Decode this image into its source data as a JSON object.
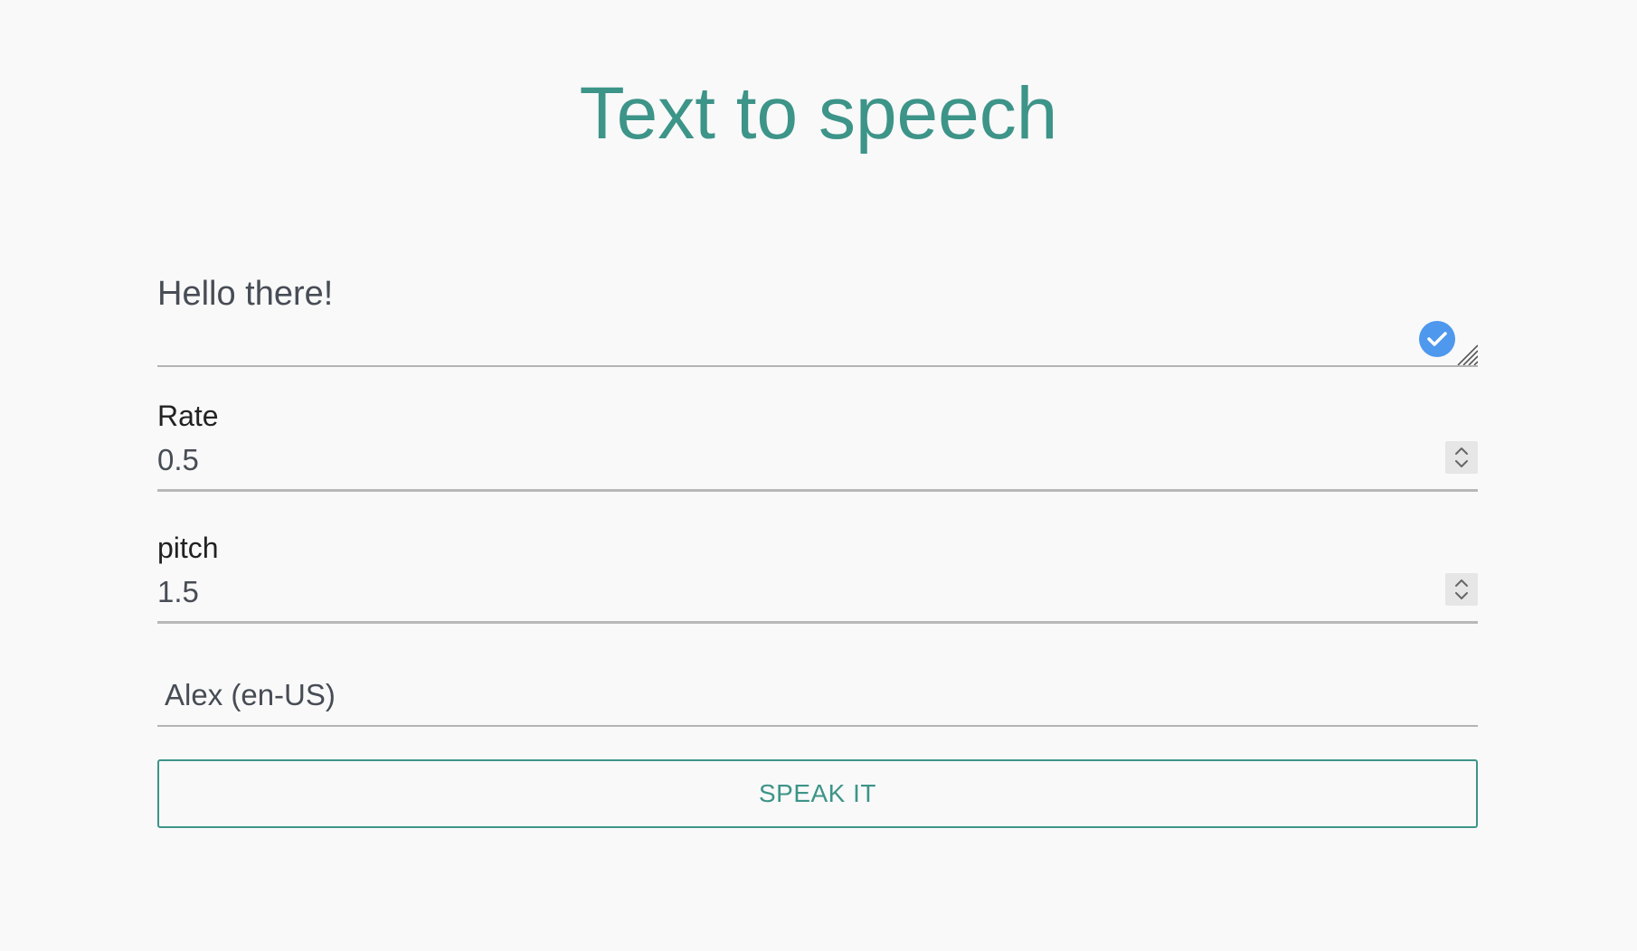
{
  "header": {
    "title": "Text to speech"
  },
  "form": {
    "text": {
      "value": "Hello there!"
    },
    "rate": {
      "label": "Rate",
      "value": "0.5"
    },
    "pitch": {
      "label": "pitch",
      "value": "1.5"
    },
    "voice": {
      "selected": "Alex (en-US)"
    },
    "speak_button": {
      "label": "SPEAK IT"
    }
  },
  "icons": {
    "check": "check-circle-icon",
    "resize": "resize-handle-icon",
    "spinner": "spinner-arrows-icon"
  },
  "colors": {
    "accent": "#3d9488",
    "badge": "#4e98ed",
    "background": "#f9f9f9"
  }
}
